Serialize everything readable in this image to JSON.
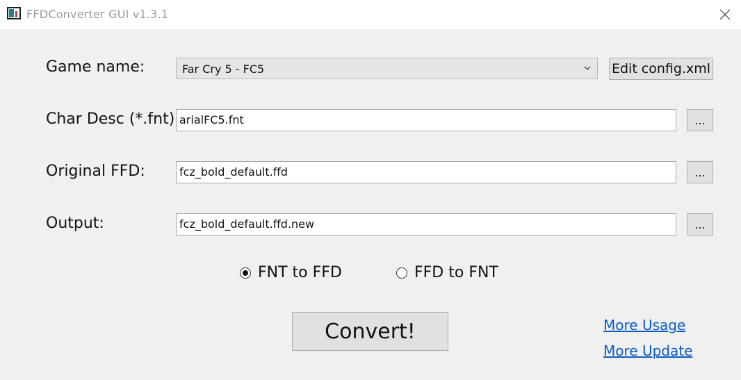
{
  "window": {
    "title": "FFDConverter GUI v1.3.1",
    "close_icon": "close-icon"
  },
  "form": {
    "game_name_label": "Game name:",
    "game_name_value": "Far Cry 5 - FC5",
    "edit_config_label": "Edit config.xml",
    "char_desc_label": "Char Desc (*.fnt):",
    "char_desc_value": "arialFC5.fnt",
    "original_ffd_label": "Original FFD:",
    "original_ffd_value": "fcz_bold_default.ffd",
    "output_label": "Output:",
    "output_value": "fcz_bold_default.ffd.new",
    "browse_label": "..."
  },
  "mode": {
    "options": [
      {
        "label": "FNT to FFD",
        "checked": true
      },
      {
        "label": "FFD to FNT",
        "checked": false
      }
    ]
  },
  "actions": {
    "convert_label": "Convert!",
    "more_usage_label": "More Usage",
    "more_update_label": "More Update"
  },
  "colors": {
    "link": "#0b5bc7",
    "background": "#f0f0f0"
  }
}
